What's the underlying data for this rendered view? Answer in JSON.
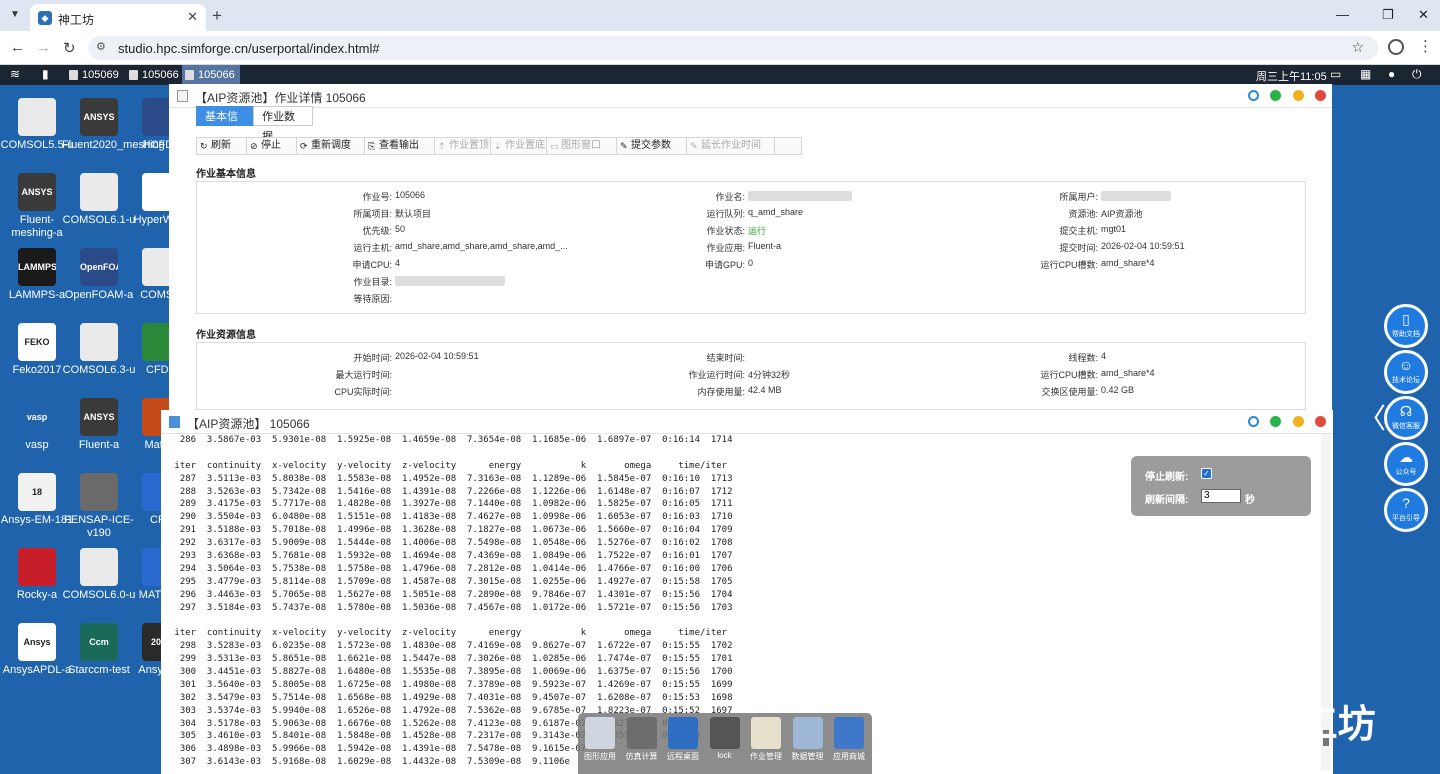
{
  "browser": {
    "tab_title": "神工坊",
    "url": "studio.hpc.simforge.cn/userportal/index.html#"
  },
  "top_taskbar": {
    "tasks": [
      "105069",
      "105066",
      "105066"
    ],
    "clock": "周三上午11:05"
  },
  "desktop_icons": [
    {
      "label": "COMSOL5.5-u",
      "badge": "",
      "color": "#eaeaea"
    },
    {
      "label": "Fluent2020_meshing",
      "badge": "ANSYS FLUENT",
      "color": "#3a3a3a"
    },
    {
      "label": "HCFDL",
      "badge": "",
      "color": "#2a4a8a"
    },
    {
      "label": "Fluent-meshing-a",
      "badge": "ANSYS FLUENT",
      "color": "#3a3a3a"
    },
    {
      "label": "COMSOL6.1-u",
      "badge": "",
      "color": "#eaeaea"
    },
    {
      "label": "HyperWo a",
      "badge": "",
      "color": "#ffffff"
    },
    {
      "label": "LAMMPS-a",
      "badge": "LAMMPS",
      "color": "#1a1a1a"
    },
    {
      "label": "OpenFOAM-a",
      "badge": "OpenFOAM",
      "color": "#2a4a8a"
    },
    {
      "label": "COMSO",
      "badge": "",
      "color": "#eaeaea"
    },
    {
      "label": "Feko2017",
      "badge": "FEKO",
      "color": "#ffffff"
    },
    {
      "label": "COMSOL6.3-u",
      "badge": "",
      "color": "#eaeaea"
    },
    {
      "label": "CFDP",
      "badge": "",
      "color": "#2a8a3a"
    },
    {
      "label": "vasp",
      "badge": "vasp",
      "color": "#1f63ac"
    },
    {
      "label": "Fluent-a",
      "badge": "ANSYS FLUENT",
      "color": "#3a3a3a"
    },
    {
      "label": "Matlab",
      "badge": "",
      "color": "#c44a1a"
    },
    {
      "label": "Ansys-EM-181",
      "badge": "18",
      "color": "#f1f1f1"
    },
    {
      "label": "FENSAP-ICE-v190",
      "badge": "",
      "color": "#6a6a6a"
    },
    {
      "label": "CFX",
      "badge": "",
      "color": "#2a6ad0"
    },
    {
      "label": "Rocky-a",
      "badge": "",
      "color": "#c81e2a"
    },
    {
      "label": "COMSOL6.0-u",
      "badge": "",
      "color": "#eaeaea"
    },
    {
      "label": "MATLA b",
      "badge": "",
      "color": "#2a6ad0"
    },
    {
      "label": "AnsysAPDL-a",
      "badge": "Ansys APDL",
      "color": "#ffffff"
    },
    {
      "label": "Starccm-test",
      "badge": "Ccm",
      "color": "#1a6a5a"
    },
    {
      "label": "Ansys 21",
      "badge": "2021",
      "color": "#2a2a2a"
    }
  ],
  "job_window": {
    "title": "【AIP资源池】作业详情 105066",
    "tabs": [
      "基本信息",
      "作业数据"
    ],
    "toolbar": [
      {
        "icon": "refresh-icon",
        "label": "刷新",
        "enabled": true
      },
      {
        "icon": "stop-icon",
        "label": "停止",
        "enabled": true
      },
      {
        "icon": "reschedule-icon",
        "label": "重新调度",
        "enabled": true
      },
      {
        "icon": "output-icon",
        "label": "查看输出",
        "enabled": true
      },
      {
        "icon": "pin-top-icon",
        "label": "作业置顶",
        "enabled": false
      },
      {
        "icon": "pin-bottom-icon",
        "label": "作业置底",
        "enabled": false
      },
      {
        "icon": "graphic-window-icon",
        "label": "图形窗口",
        "enabled": false
      },
      {
        "icon": "submit-params-icon",
        "label": "提交参数",
        "enabled": true
      },
      {
        "icon": "extend-time-icon",
        "label": "延长作业时间",
        "enabled": false
      }
    ],
    "basic_title": "作业基本信息",
    "basic": [
      [
        "作业号:",
        "105066",
        "作业名:",
        "",
        "所属用户:",
        ""
      ],
      [
        "所属项目:",
        "默认项目",
        "运行队列:",
        "q_amd_share",
        "资源池:",
        "AIP资源池"
      ],
      [
        "优先级:",
        "50",
        "作业状态:",
        "运行",
        "提交主机:",
        "mgt01"
      ],
      [
        "运行主机:",
        "amd_share,amd_share,amd_share,amd_...",
        "作业应用:",
        "Fluent-a",
        "提交时间:",
        "2026-02-04 10:59:51"
      ],
      [
        "申请CPU:",
        "4",
        "申请GPU:",
        "0",
        "运行CPU槽数:",
        "amd_share*4"
      ],
      [
        "作业目录:",
        "",
        "",
        "",
        "",
        ""
      ],
      [
        "等待原因:",
        "",
        "",
        "",
        "",
        ""
      ]
    ],
    "resource_title": "作业资源信息",
    "resource": [
      [
        "开始时间:",
        "2026-02-04 10:59:51",
        "结束时间:",
        "",
        "线程数:",
        "4"
      ],
      [
        "最大运行时间:",
        "",
        "作业运行时间:",
        "4分钟32秒",
        "运行CPU槽数:",
        "amd_share*4"
      ],
      [
        "CPU实际时间:",
        "",
        "内存使用量:",
        "42.4 MB",
        "交换区使用量:",
        "0.42 GB"
      ]
    ],
    "status_color": "#23a323"
  },
  "log_window": {
    "title": "【AIP资源池】 105066",
    "lines": [
      "  286  3.5867e-03  5.9301e-08  1.5925e-08  1.4659e-08  7.3654e-08  1.1685e-06  1.6897e-07  0:16:14  1714",
      "",
      " iter  continuity  x-velocity  y-velocity  z-velocity      energy           k       omega     time/iter",
      "  287  3.5113e-03  5.8038e-08  1.5583e-08  1.4952e-08  7.3163e-08  1.1289e-06  1.5845e-07  0:16:10  1713",
      "  288  3.5263e-03  5.7342e-08  1.5416e-08  1.4391e-08  7.2266e-08  1.1226e-06  1.6148e-07  0:16:07  1712",
      "  289  3.4175e-03  5.7717e-08  1.4828e-08  1.3927e-08  7.1440e-08  1.0982e-06  1.5825e-07  0:16:05  1711",
      "  290  3.5504e-03  6.0480e-08  1.5151e-08  1.4183e-08  7.4627e-08  1.0998e-06  1.6053e-07  0:16:03  1710",
      "  291  3.5188e-03  5.7018e-08  1.4996e-08  1.3628e-08  7.1827e-08  1.0673e-06  1.5660e-07  0:16:04  1709",
      "  292  3.6317e-03  5.9009e-08  1.5444e-08  1.4006e-08  7.5498e-08  1.0548e-06  1.5276e-07  0:16:02  1708",
      "  293  3.6368e-03  5.7681e-08  1.5932e-08  1.4694e-08  7.4369e-08  1.0849e-06  1.7522e-07  0:16:01  1707",
      "  294  3.5064e-03  5.7538e-08  1.5758e-08  1.4796e-08  7.2812e-08  1.0414e-06  1.4766e-07  0:16:00  1706",
      "  295  3.4779e-03  5.8114e-08  1.5709e-08  1.4587e-08  7.3015e-08  1.0255e-06  1.4927e-07  0:15:58  1705",
      "  296  3.4463e-03  5.7065e-08  1.5627e-08  1.5051e-08  7.2890e-08  9.7846e-07  1.4301e-07  0:15:56  1704",
      "  297  3.5184e-03  5.7437e-08  1.5780e-08  1.5036e-08  7.4567e-08  1.0172e-06  1.5721e-07  0:15:56  1703",
      "",
      " iter  continuity  x-velocity  y-velocity  z-velocity      energy           k       omega     time/iter",
      "  298  3.5283e-03  6.0235e-08  1.5723e-08  1.4830e-08  7.4169e-08  9.8627e-07  1.6722e-07  0:15:55  1702",
      "  299  3.5313e-03  5.8651e-08  1.6621e-08  1.5447e-08  7.3026e-08  1.0285e-06  1.7474e-07  0:15:55  1701",
      "  300  3.4451e-03  5.8827e-08  1.6480e-08  1.5535e-08  7.3895e-08  1.0069e-06  1.6375e-07  0:15:56  1700",
      "  301  3.5640e-03  5.8005e-08  1.6725e-08  1.4980e-08  7.3789e-08  9.5923e-07  1.4269e-07  0:15:55  1699",
      "  302  3.5479e-03  5.7514e-08  1.6568e-08  1.4929e-08  7.4031e-08  9.4507e-07  1.6208e-07  0:15:53  1698",
      "  303  3.5374e-03  5.9940e-08  1.6526e-08  1.4792e-08  7.5362e-08  9.6785e-07  1.8223e-07  0:15:52  1697",
      "  304  3.5178e-03  5.9063e-08  1.6676e-08  1.5262e-08  7.4123e-08  9.6187e-07  1.6627e-07  0:15:51  1696",
      "  305  3.4610e-03  5.8401e-08  1.5848e-08  1.4528e-08  7.2317e-08  9.3143e-07  1.6455e-07  0:15:50  1695",
      "  306  3.4898e-03  5.9966e-08  1.5942e-08  1.4391e-08  7.5478e-08  9.1615e-07",
      "  307  3.6143e-03  5.9168e-08  1.6029e-08  1.4432e-08  7.5309e-08  9.1106e",
      "  308  3.4703e-03  5.8458e-08  1.6012e-08  1.4467e-08  7.2183e-08  8.8819",
      "",
      " iter  continuity  x-velocity  y-velocity  z-velocity      energy"
    ],
    "refresh": {
      "stop_label": "停止刷新:",
      "interval_label": "刷新间隔:",
      "interval_value": "3",
      "unit": "秒"
    }
  },
  "right_panel": [
    "帮助文档",
    "技术论坛",
    "微信客服",
    "公众号",
    "平台引导"
  ],
  "dock": [
    "图形应用",
    "仿真计算",
    "远程桌面",
    "lock",
    "作业管理",
    "数据管理",
    "应用商城"
  ],
  "watermark": "知乎 @神工坊"
}
